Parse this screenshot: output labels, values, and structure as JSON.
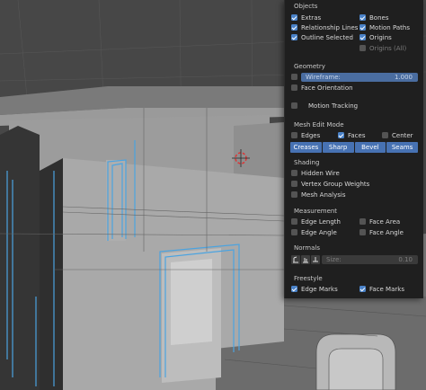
{
  "overlay": {
    "objects": {
      "title": "Objects",
      "extras": {
        "label": "Extras",
        "checked": true
      },
      "relationship_lines": {
        "label": "Relationship Lines",
        "checked": true
      },
      "outline_selected": {
        "label": "Outline Selected",
        "checked": true
      },
      "bones": {
        "label": "Bones",
        "checked": true
      },
      "motion_paths": {
        "label": "Motion Paths",
        "checked": true
      },
      "origins": {
        "label": "Origins",
        "checked": true
      },
      "origins_all": {
        "label": "Origins (All)",
        "checked": false
      }
    },
    "geometry": {
      "title": "Geometry",
      "wireframe": {
        "label": "Wireframe:",
        "value": "1.000",
        "checked": false
      },
      "face_orientation": {
        "label": "Face Orientation",
        "checked": false
      },
      "motion_tracking": {
        "label": "Motion Tracking",
        "checked": false
      }
    },
    "mesh_edit_mode": {
      "title": "Mesh Edit Mode",
      "edges": {
        "label": "Edges",
        "checked": false
      },
      "faces": {
        "label": "Faces",
        "checked": true
      },
      "center": {
        "label": "Center",
        "checked": false
      },
      "buttons": [
        "Creases",
        "Sharp",
        "Bevel",
        "Seams"
      ]
    },
    "shading": {
      "title": "Shading",
      "hidden_wire": {
        "label": "Hidden Wire",
        "checked": false
      },
      "vertex_group_weights": {
        "label": "Vertex Group Weights",
        "checked": false
      },
      "mesh_analysis": {
        "label": "Mesh Analysis",
        "checked": false
      }
    },
    "measurement": {
      "title": "Measurement",
      "edge_length": {
        "label": "Edge Length",
        "checked": false
      },
      "edge_angle": {
        "label": "Edge Angle",
        "checked": false
      },
      "face_area": {
        "label": "Face Area",
        "checked": false
      },
      "face_angle": {
        "label": "Face Angle",
        "checked": false
      }
    },
    "normals": {
      "title": "Normals",
      "size_label": "Size:",
      "size_value": "0.10"
    },
    "freestyle": {
      "title": "Freestyle",
      "edge_marks": {
        "label": "Edge Marks",
        "checked": true
      },
      "face_marks": {
        "label": "Face Marks",
        "checked": true
      }
    }
  },
  "colors": {
    "accent": "#4a82c8",
    "selected_edges": "#4aa3e0",
    "panel_bg": "#1f1f1f"
  }
}
